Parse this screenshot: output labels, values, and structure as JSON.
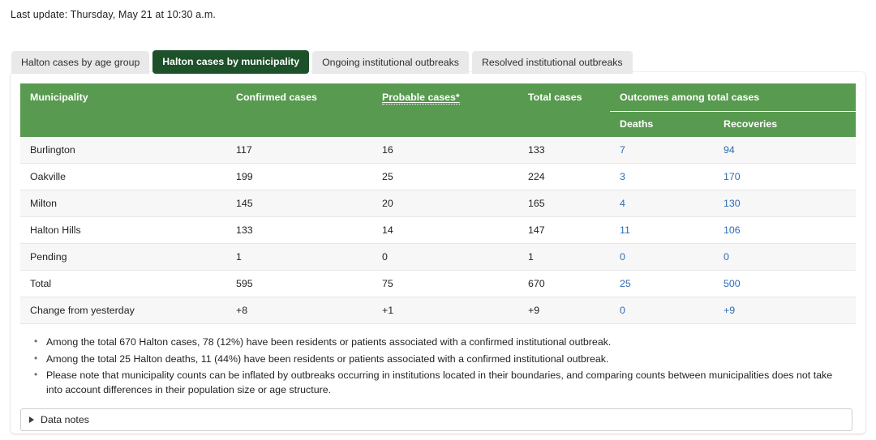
{
  "header": {
    "last_update": "Last update: Thursday, May 21 at 10:30 a.m."
  },
  "tabs": [
    {
      "label": "Halton cases by age group",
      "active": false
    },
    {
      "label": "Halton cases by municipality",
      "active": true
    },
    {
      "label": "Ongoing institutional outbreaks",
      "active": false
    },
    {
      "label": "Resolved institutional outbreaks",
      "active": false
    }
  ],
  "table": {
    "columns": {
      "municipality": "Municipality",
      "confirmed": "Confirmed cases",
      "probable": "Probable cases*",
      "total": "Total cases",
      "group": "Outcomes among total cases",
      "deaths": "Deaths",
      "recoveries": "Recoveries"
    },
    "rows": [
      {
        "municipality": "Burlington",
        "confirmed": "117",
        "probable": "16",
        "total": "133",
        "deaths": "7",
        "recoveries": "94"
      },
      {
        "municipality": "Oakville",
        "confirmed": "199",
        "probable": "25",
        "total": "224",
        "deaths": "3",
        "recoveries": "170"
      },
      {
        "municipality": "Milton",
        "confirmed": "145",
        "probable": "20",
        "total": "165",
        "deaths": "4",
        "recoveries": "130"
      },
      {
        "municipality": "Halton Hills",
        "confirmed": "133",
        "probable": "14",
        "total": "147",
        "deaths": "11",
        "recoveries": "106"
      },
      {
        "municipality": "Pending",
        "confirmed": "1",
        "probable": "0",
        "total": "1",
        "deaths": "0",
        "recoveries": "0"
      },
      {
        "municipality": "Total",
        "confirmed": "595",
        "probable": "75",
        "total": "670",
        "deaths": "25",
        "recoveries": "500"
      },
      {
        "municipality": "Change from yesterday",
        "confirmed": "+8",
        "probable": "+1",
        "total": "+9",
        "deaths": "0",
        "recoveries": "+9"
      }
    ]
  },
  "notes": [
    "Among the total 670 Halton cases, 78 (12%) have been residents or patients associated with a confirmed institutional outbreak.",
    "Among the total 25 Halton deaths, 11 (44%) have been residents or patients associated with a confirmed institutional outbreak.",
    "Please note that municipality counts can be inflated by outbreaks occurring in institutions located in their boundaries, and comparing counts between municipalities does not take into account differences in their population size or age structure."
  ],
  "data_notes": {
    "label": "Data notes",
    "icon": "triangle-right-icon",
    "expanded": false
  },
  "colors": {
    "header_green": "#589a4f",
    "active_tab_green": "#1d5129",
    "inactive_tab_gray": "#e9e9e9",
    "link_blue": "#2d6cb3",
    "row_stripe": "#f7f7f7"
  }
}
